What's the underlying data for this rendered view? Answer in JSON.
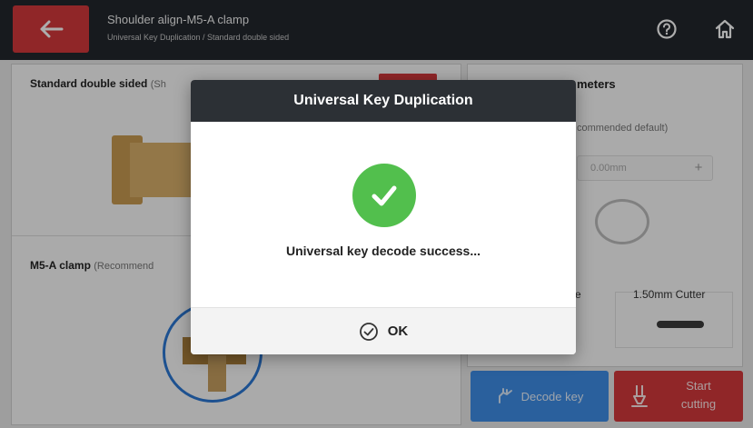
{
  "header": {
    "title": "Shoulder align-M5-A clamp",
    "subtitle": "Universal Key Duplication / Standard double sided"
  },
  "left_panel": {
    "key_section_title": "Standard double sided",
    "key_section_hint": "(Sh",
    "clamp_section_title": "M5-A clamp",
    "clamp_section_hint": "(Recommend"
  },
  "right_panel": {
    "params_title": "meters",
    "params_hint": "commended default)",
    "stepper_value": "0.00mm",
    "stepper_plus": "+",
    "cutter_left_label": "e",
    "cutter_label": "1.50mm Cutter"
  },
  "buttons": {
    "decode": "Decode key",
    "start_line1": "Start",
    "start_line2": "cutting"
  },
  "dialog": {
    "title": "Universal Key Duplication",
    "message": "Universal key decode success...",
    "ok": "OK"
  },
  "colors": {
    "accent_red": "#d5383c",
    "accent_blue": "#3e8ee8",
    "success_green": "#52bf4d",
    "header_dark": "#22272d"
  },
  "icons": {
    "back": "arrow-left-icon",
    "help": "help-circle-icon",
    "home": "home-icon",
    "success": "check-icon",
    "ok": "check-circle-icon",
    "decode": "key-hand-icon",
    "cut": "cutter-icon"
  }
}
